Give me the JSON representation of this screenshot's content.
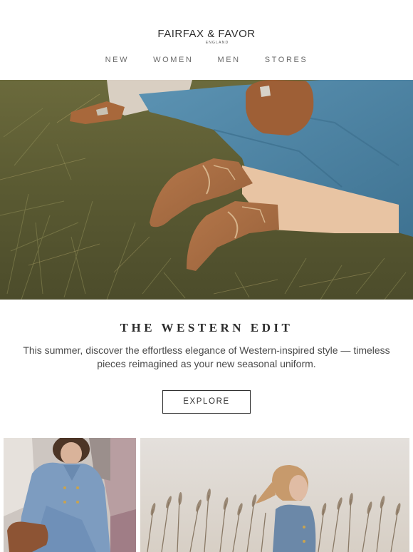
{
  "header": {
    "logo_main": "FAIRFAX & FAVOR",
    "logo_sub": "ENGLAND",
    "nav": [
      "NEW",
      "WOMEN",
      "MEN",
      "STORES"
    ]
  },
  "hero": {
    "image": "hero-western-boots-on-grass"
  },
  "edit": {
    "title": "THE WESTERN EDIT",
    "body": "This summer, discover the effortless elegance of Western-inspired style — timeless pieces reimagined as your new seasonal uniform.",
    "cta": "EXPLORE"
  },
  "tiles": [
    {
      "image": "woman-in-blue-tweed-jacket"
    },
    {
      "image": "woman-in-reeds-field"
    }
  ],
  "colors": {
    "text": "#2b2b2b",
    "nav": "#6a6a6a",
    "grass": "#5e5a36",
    "denim": "#4a7d9c",
    "tan": "#a86a3e"
  }
}
